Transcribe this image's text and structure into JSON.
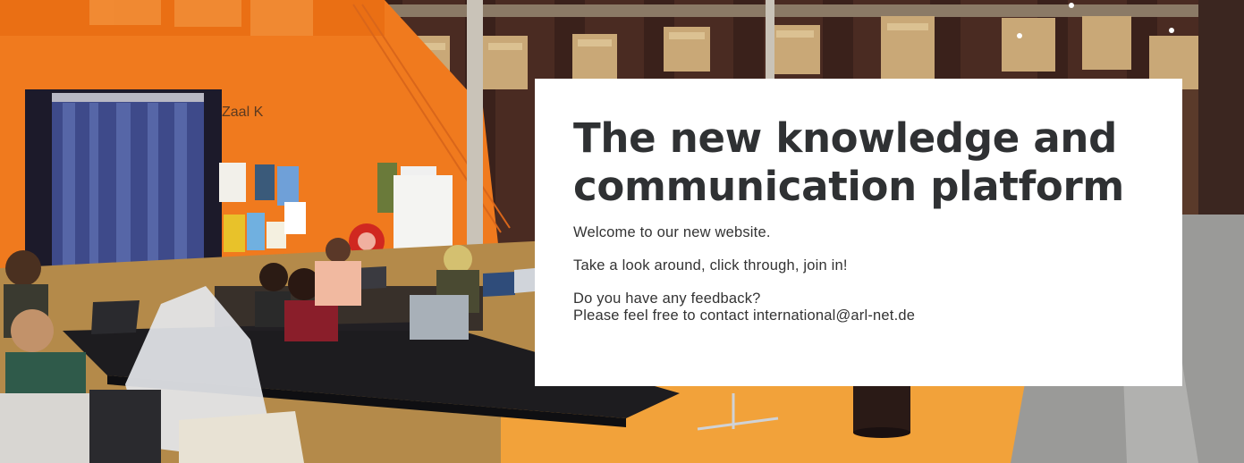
{
  "hero": {
    "background_scene": "library-study-hall-photo",
    "wall_sign": "Zaal K",
    "colors": {
      "orange_wall": "#f07a1e",
      "orange_floor": "#f2a23a",
      "brick": "#4a2a22",
      "card_bg": "#ffffff",
      "heading_text": "#2f3133",
      "body_text": "#333333"
    }
  },
  "card": {
    "title_line1": "The new knowledge and",
    "title_line2": "communication platform",
    "welcome": "Welcome to our new website.",
    "explore": "Take a look around, click through, join in!",
    "feedback_q": "Do you have any feedback?",
    "contact_prefix": "Please feel free to contact ",
    "contact_email": "international@arl-net.de"
  }
}
